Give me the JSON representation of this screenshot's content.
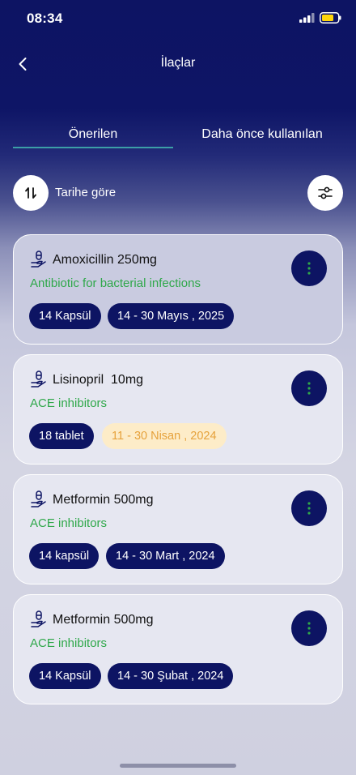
{
  "status_bar": {
    "time": "08:34"
  },
  "header": {
    "title": "İlaçlar"
  },
  "tabs": [
    {
      "label": "Önerilen",
      "active": true
    },
    {
      "label": "Daha önce kullanılan",
      "active": false
    }
  ],
  "sort": {
    "label": "Tarihe göre"
  },
  "medications": [
    {
      "name": "Amoxicillin 250mg",
      "description": "Antibiotic for bacterial infections",
      "quantity": "14 Kapsül",
      "date_range": "14 - 30 Mayıs , 2025",
      "date_status": "active"
    },
    {
      "name": "Lisinopril  10mg",
      "description": "ACE inhibitors",
      "quantity": "18 tablet",
      "date_range": "11 - 30 Nisan , 2024",
      "date_status": "warning"
    },
    {
      "name": "Metformin 500mg",
      "description": "ACE inhibitors",
      "quantity": "14 kapsül",
      "date_range": "14 - 30 Mart , 2024",
      "date_status": "normal"
    },
    {
      "name": "Metformin 500mg",
      "description": "ACE inhibitors",
      "quantity": "14 Kapsül",
      "date_range": "14 - 30 Şubat , 2024",
      "date_status": "normal"
    }
  ],
  "colors": {
    "primary": "#0d1463",
    "accent_green": "#2fa84a",
    "warning_text": "#e6a23c",
    "warning_bg": "#fdecc8",
    "tab_underline": "#3c9fa6"
  },
  "icons": {
    "back": "chevron-left-icon",
    "sort": "sort-arrows-icon",
    "filter": "filter-sliders-icon",
    "medication": "medication-hand-icon",
    "more": "more-vertical-icon"
  }
}
